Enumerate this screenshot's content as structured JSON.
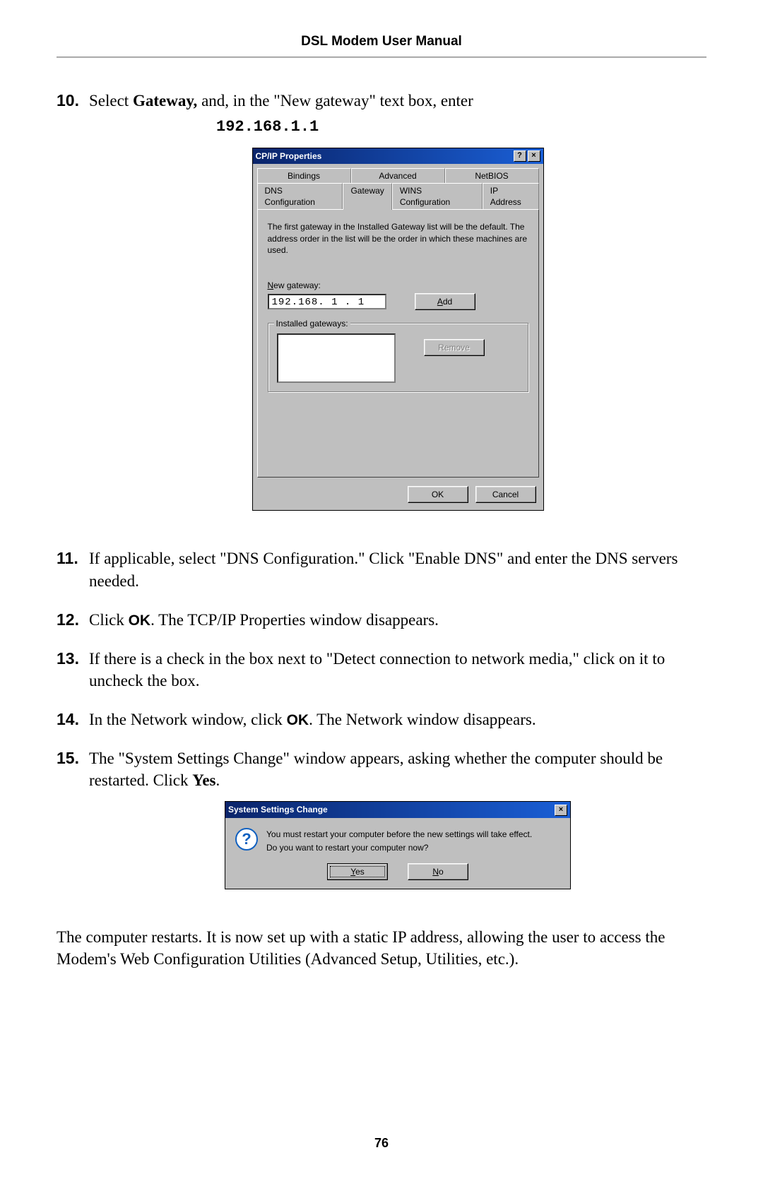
{
  "header": {
    "title": "DSL Modem User Manual"
  },
  "steps": {
    "s10": {
      "num": "10.",
      "text_a": "Select ",
      "bold_a": "Gateway,",
      "text_b": " and, in the \"New gateway\" text box, enter",
      "ip": "192.168.1.1"
    },
    "s11": {
      "num": "11.",
      "text": "If applicable, select \"DNS Configuration.\" Click \"Enable DNS\" and enter the DNS servers needed."
    },
    "s12": {
      "num": "12.",
      "text_a": "Click ",
      "bold_a": "OK",
      "text_b": ". The ",
      "sc": "TCP/IP",
      "text_c": " Properties window disappears."
    },
    "s13": {
      "num": "13.",
      "text": "If there is a check in the box next to \"Detect connection to network media,\" click on it to uncheck the box."
    },
    "s14": {
      "num": "14.",
      "text_a": "In the Network window, click ",
      "bold_a": "OK",
      "text_b": ". The Network window disappears."
    },
    "s15": {
      "num": "15.",
      "text_a": "The \"System Settings Change\" window appears, asking whether the computer should be restarted. Click ",
      "bold_a": "Yes",
      "text_b": "."
    }
  },
  "closing": "The computer restarts. It is now set up with a static IP address, allowing the user to access the Modem's Web Configuration Utilities (Advanced Setup, Utilities, etc.).",
  "page_number": "76",
  "dialog1": {
    "title": "CP/IP Properties",
    "help_btn": "?",
    "close_btn": "×",
    "tabs_row1": [
      "Bindings",
      "Advanced",
      "NetBIOS"
    ],
    "tabs_row2": [
      "DNS Configuration",
      "Gateway",
      "WINS Configuration",
      "IP Address"
    ],
    "help_text": "The first gateway in the Installed Gateway list will be the default. The address order in the list will be the order in which these machines are used.",
    "new_gateway_label": "New gateway:",
    "new_gateway_value": "192.168. 1 . 1",
    "add_btn": "Add",
    "installed_label": "Installed gateways:",
    "remove_btn": "Remove",
    "ok_btn": "OK",
    "cancel_btn": "Cancel"
  },
  "dialog2": {
    "title": "System Settings Change",
    "close_btn": "×",
    "msg1": "You must restart your computer before the new settings will take effect.",
    "msg2": "Do you want to restart your computer now?",
    "yes_btn": "Yes",
    "no_btn": "No"
  }
}
